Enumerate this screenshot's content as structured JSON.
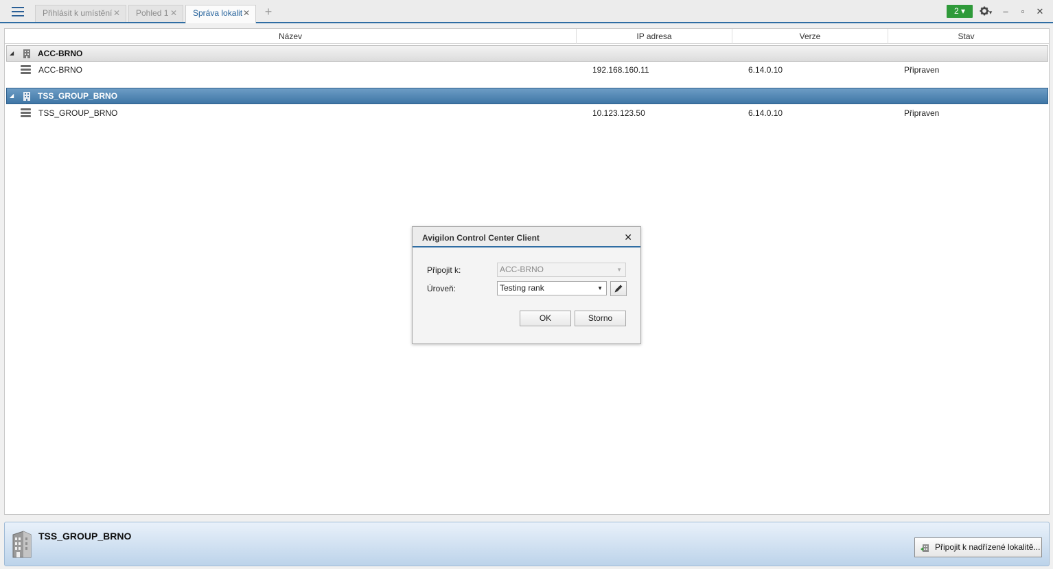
{
  "tabs": [
    {
      "label": "Přihlásit k umístění",
      "active": false
    },
    {
      "label": "Pohled 1",
      "active": false
    },
    {
      "label": "Správa lokalit",
      "active": true
    }
  ],
  "toolbar": {
    "notifications": "2 ▾",
    "settings_icon": "gear-icon",
    "settings_arrow": "▾",
    "minimize": "‒",
    "maximize": "▫",
    "close": "✕"
  },
  "grid": {
    "columns": [
      "Název",
      "IP adresa",
      "Verze",
      "Stav"
    ],
    "groups": [
      {
        "name": "ACC-BRNO",
        "selected": false,
        "rows": [
          {
            "name": "ACC-BRNO",
            "ip": "192.168.160.11",
            "version": "6.14.0.10",
            "status": "Připraven"
          }
        ]
      },
      {
        "name": "TSS_GROUP_BRNO",
        "selected": true,
        "rows": [
          {
            "name": "TSS_GROUP_BRNO",
            "ip": "10.123.123.50",
            "version": "6.14.0.10",
            "status": "Připraven"
          }
        ]
      }
    ]
  },
  "dialog": {
    "title": "Avigilon Control Center Client",
    "connect_label": "Připojit k:",
    "connect_value": "ACC-BRNO",
    "level_label": "Úroveň:",
    "level_value": "Testing rank",
    "ok_label": "OK",
    "cancel_label": "Storno"
  },
  "details": {
    "site_name": "TSS_GROUP_BRNO",
    "connect_parent_label": "Připojit k nadřízené lokalitě..."
  },
  "colors": {
    "accent": "#2f6da3",
    "selected_row": "#4a80ae",
    "notification": "#2f9a3a"
  }
}
